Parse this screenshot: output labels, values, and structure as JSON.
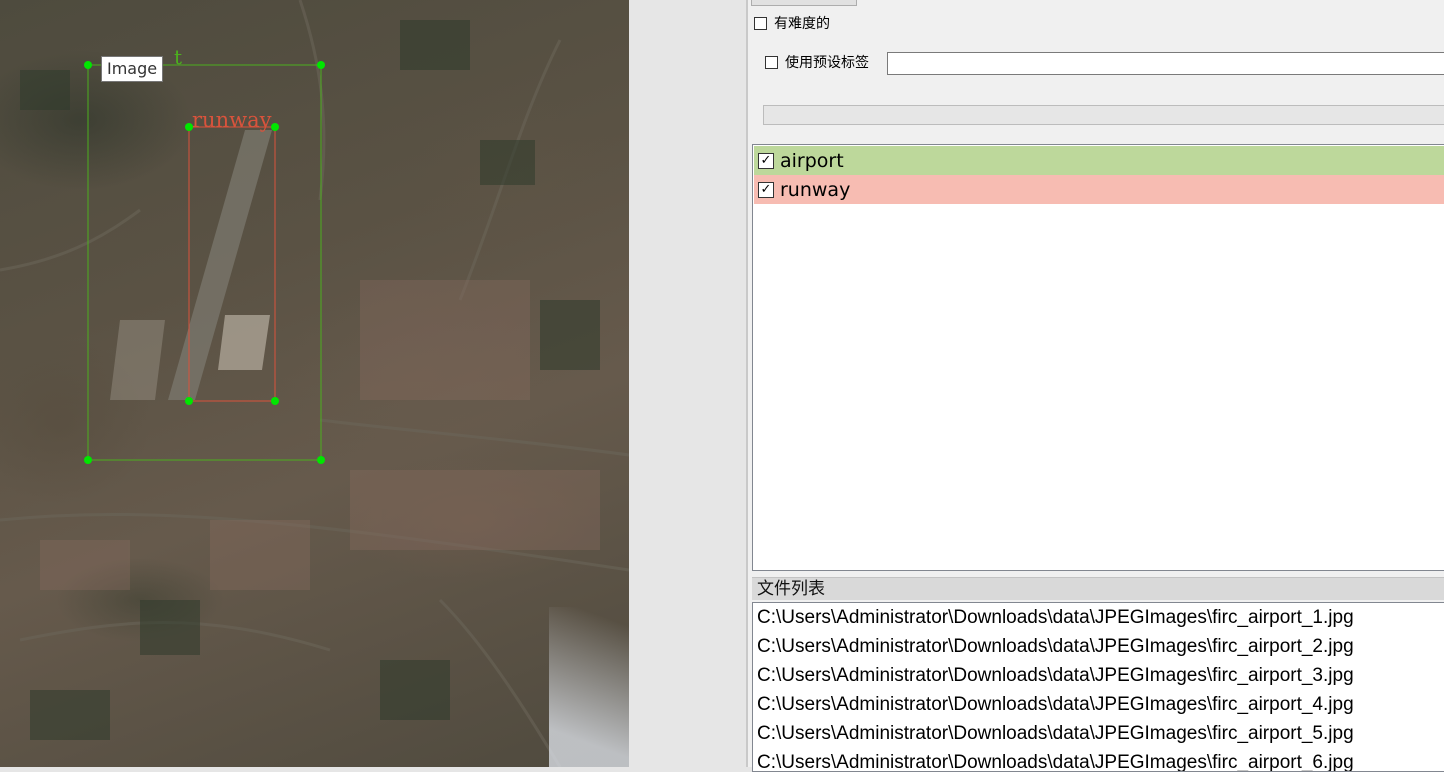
{
  "canvas": {
    "tooltip": "Image",
    "boxes": [
      {
        "label": "airport",
        "color": "#4caf1e",
        "visible_label": "t"
      },
      {
        "label": "runway",
        "color": "#d9533c",
        "visible_label": "runway"
      }
    ]
  },
  "panel": {
    "difficult_label": "有难度的",
    "use_preset_label": "使用预设标签",
    "preset_value": "",
    "labels": [
      {
        "name": "airport",
        "checked": true,
        "bg": "#bdd89b"
      },
      {
        "name": "runway",
        "checked": true,
        "bg": "#f7bcb2"
      }
    ],
    "file_list_title": "文件列表",
    "files": [
      "C:\\Users\\Administrator\\Downloads\\data\\JPEGImages\\firc_airport_1.jpg",
      "C:\\Users\\Administrator\\Downloads\\data\\JPEGImages\\firc_airport_2.jpg",
      "C:\\Users\\Administrator\\Downloads\\data\\JPEGImages\\firc_airport_3.jpg",
      "C:\\Users\\Administrator\\Downloads\\data\\JPEGImages\\firc_airport_4.jpg",
      "C:\\Users\\Administrator\\Downloads\\data\\JPEGImages\\firc_airport_5.jpg",
      "C:\\Users\\Administrator\\Downloads\\data\\JPEGImages\\firc_airport_6.jpg"
    ]
  }
}
